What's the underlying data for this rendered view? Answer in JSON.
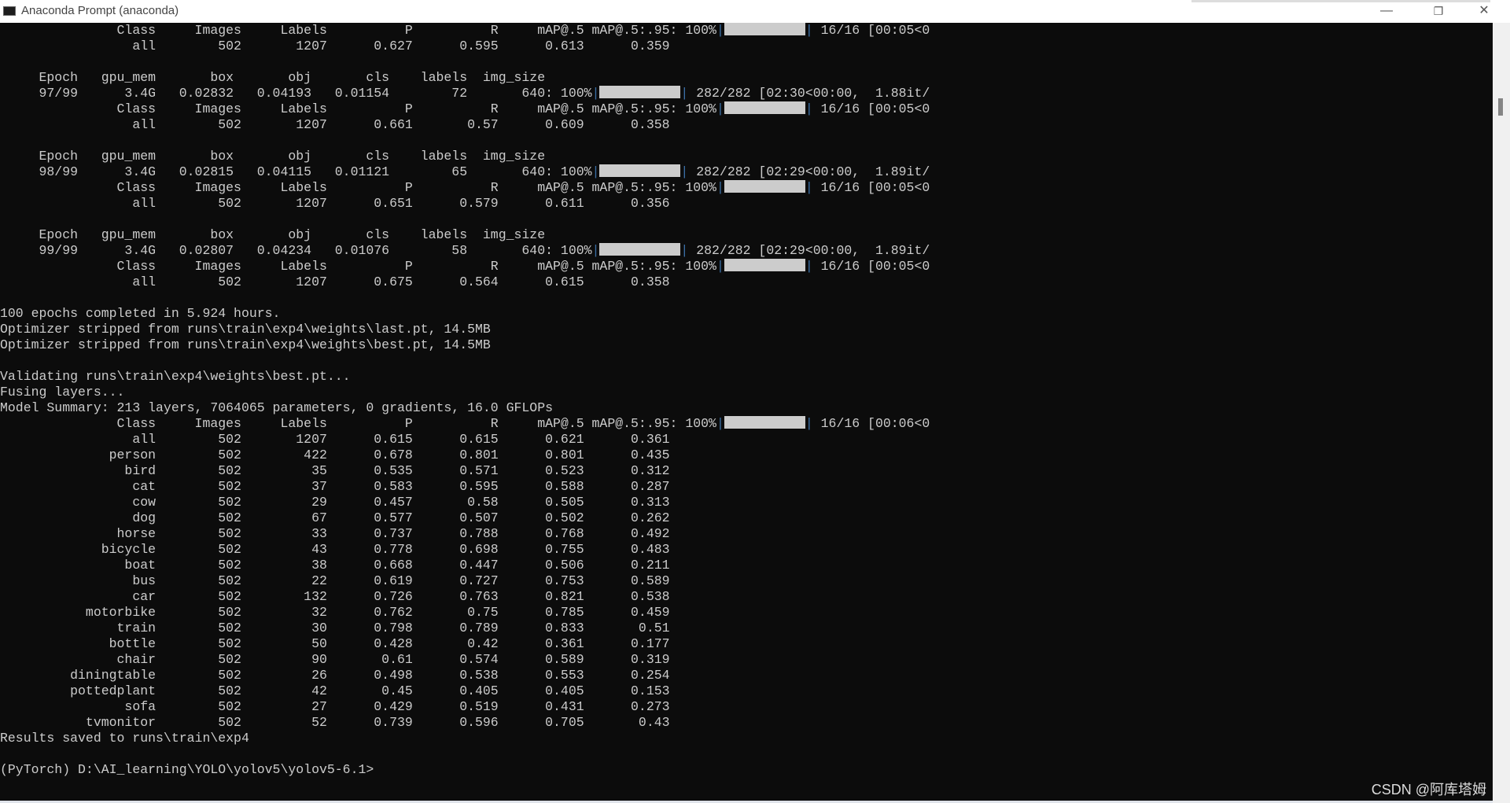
{
  "window": {
    "title": "Anaconda Prompt (anaconda)",
    "buttons": {
      "minimize": "—",
      "restore": "❐",
      "close": "✕"
    }
  },
  "colors": {
    "background": "#0c0c0c",
    "text": "#cccccc",
    "progress_bar": "#cccccc"
  },
  "lines": [
    {
      "text": "               Class     Images     Labels          P          R     mAP@.5 mAP@.5:.95: 100%",
      "bar": true,
      "after": " 16/16 [00:05<0"
    },
    {
      "text": "                 all        502       1207      0.627      0.595      0.613      0.359"
    },
    {
      "text": ""
    },
    {
      "text": "     Epoch   gpu_mem       box       obj       cls    labels  img_size"
    },
    {
      "text": "     97/99      3.4G   0.02832   0.04193   0.01154        72       640: 100%",
      "bar": true,
      "after": " 282/282 [02:30<00:00,  1.88it/"
    },
    {
      "text": "               Class     Images     Labels          P          R     mAP@.5 mAP@.5:.95: 100%",
      "bar": true,
      "after": " 16/16 [00:05<0"
    },
    {
      "text": "                 all        502       1207      0.661       0.57      0.609      0.358"
    },
    {
      "text": ""
    },
    {
      "text": "     Epoch   gpu_mem       box       obj       cls    labels  img_size"
    },
    {
      "text": "     98/99      3.4G   0.02815   0.04115   0.01121        65       640: 100%",
      "bar": true,
      "after": " 282/282 [02:29<00:00,  1.89it/"
    },
    {
      "text": "               Class     Images     Labels          P          R     mAP@.5 mAP@.5:.95: 100%",
      "bar": true,
      "after": " 16/16 [00:05<0"
    },
    {
      "text": "                 all        502       1207      0.651      0.579      0.611      0.356"
    },
    {
      "text": ""
    },
    {
      "text": "     Epoch   gpu_mem       box       obj       cls    labels  img_size"
    },
    {
      "text": "     99/99      3.4G   0.02807   0.04234   0.01076        58       640: 100%",
      "bar": true,
      "after": " 282/282 [02:29<00:00,  1.89it/"
    },
    {
      "text": "               Class     Images     Labels          P          R     mAP@.5 mAP@.5:.95: 100%",
      "bar": true,
      "after": " 16/16 [00:05<0"
    },
    {
      "text": "                 all        502       1207      0.675      0.564      0.615      0.358"
    },
    {
      "text": ""
    },
    {
      "text": "100 epochs completed in 5.924 hours."
    },
    {
      "text": "Optimizer stripped from runs\\train\\exp4\\weights\\last.pt, 14.5MB"
    },
    {
      "text": "Optimizer stripped from runs\\train\\exp4\\weights\\best.pt, 14.5MB"
    },
    {
      "text": ""
    },
    {
      "text": "Validating runs\\train\\exp4\\weights\\best.pt..."
    },
    {
      "text": "Fusing layers..."
    },
    {
      "text": "Model Summary: 213 layers, 7064065 parameters, 0 gradients, 16.0 GFLOPs"
    },
    {
      "text": "               Class     Images     Labels          P          R     mAP@.5 mAP@.5:.95: 100%",
      "bar": true,
      "after": " 16/16 [00:06<0"
    },
    {
      "text": "                 all        502       1207      0.615      0.615      0.621      0.361"
    },
    {
      "text": "              person        502        422      0.678      0.801      0.801      0.435"
    },
    {
      "text": "                bird        502         35      0.535      0.571      0.523      0.312"
    },
    {
      "text": "                 cat        502         37      0.583      0.595      0.588      0.287"
    },
    {
      "text": "                 cow        502         29      0.457       0.58      0.505      0.313"
    },
    {
      "text": "                 dog        502         67      0.577      0.507      0.502      0.262"
    },
    {
      "text": "               horse        502         33      0.737      0.788      0.768      0.492"
    },
    {
      "text": "             bicycle        502         43      0.778      0.698      0.755      0.483"
    },
    {
      "text": "                boat        502         38      0.668      0.447      0.506      0.211"
    },
    {
      "text": "                 bus        502         22      0.619      0.727      0.753      0.589"
    },
    {
      "text": "                 car        502        132      0.726      0.763      0.821      0.538"
    },
    {
      "text": "           motorbike        502         32      0.762       0.75      0.785      0.459"
    },
    {
      "text": "               train        502         30      0.798      0.789      0.833       0.51"
    },
    {
      "text": "              bottle        502         50      0.428       0.42      0.361      0.177"
    },
    {
      "text": "               chair        502         90       0.61      0.574      0.589      0.319"
    },
    {
      "text": "         diningtable        502         26      0.498      0.538      0.553      0.254"
    },
    {
      "text": "         pottedplant        502         42       0.45      0.405      0.405      0.153"
    },
    {
      "text": "                sofa        502         27      0.429      0.519      0.431      0.273"
    },
    {
      "text": "           tvmonitor        502         52      0.739      0.596      0.705       0.43"
    },
    {
      "text": "Results saved to runs\\train\\exp4"
    },
    {
      "text": ""
    },
    {
      "text": "(PyTorch) D:\\AI_learning\\YOLO\\yolov5\\yolov5-6.1>"
    }
  ],
  "progress_percent": 100,
  "watermark": "CSDN @阿库塔姆"
}
